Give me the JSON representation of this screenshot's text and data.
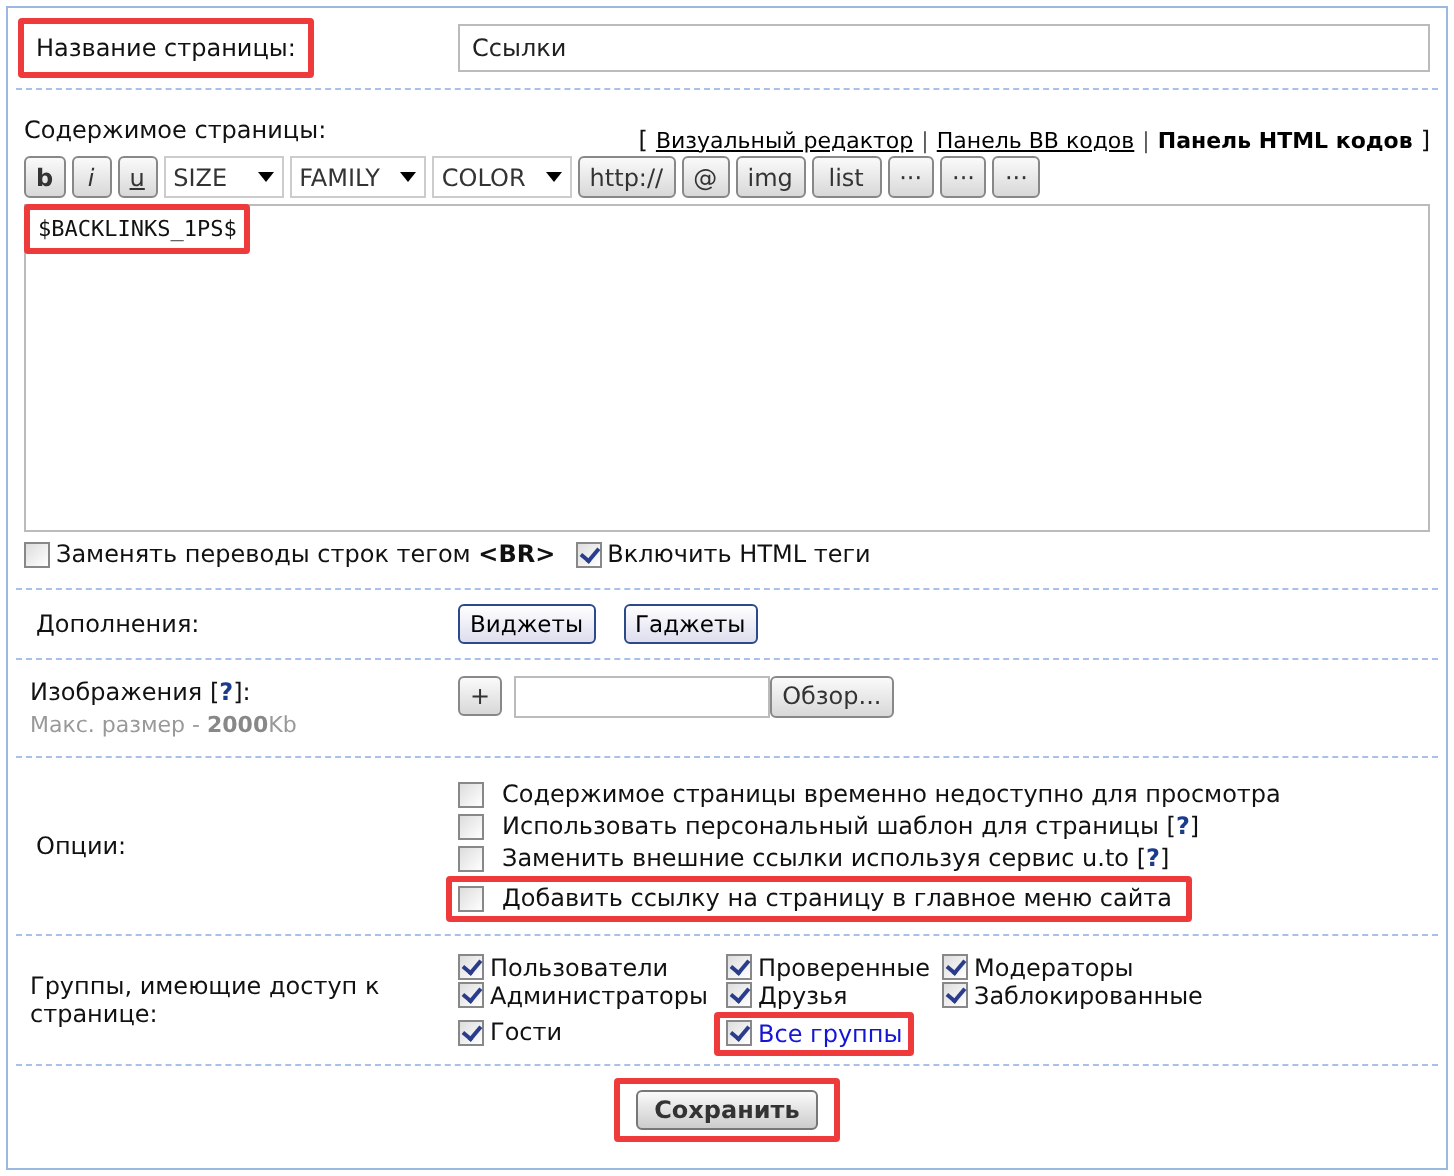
{
  "title_row": {
    "label": "Название страницы:",
    "label_highlighted": true,
    "value": "Ссылки"
  },
  "content": {
    "label": "Содержимое страницы:",
    "modes_open": "[",
    "modes_close": "]",
    "mode_separators": [
      "|",
      "|"
    ],
    "editor_modes": [
      {
        "label": "Визуальный редактор",
        "selected": false
      },
      {
        "label": "Панель BB кодов",
        "selected": false
      },
      {
        "label": "Панель HTML кодов",
        "selected": true
      }
    ],
    "toolbar": [
      {
        "kind": "button",
        "label": "b"
      },
      {
        "kind": "button",
        "label": "i"
      },
      {
        "kind": "button",
        "label": "u"
      },
      {
        "kind": "select",
        "label": "SIZE"
      },
      {
        "kind": "select",
        "label": "FAMILY"
      },
      {
        "kind": "select",
        "label": "COLOR"
      },
      {
        "kind": "button",
        "label": "http://"
      },
      {
        "kind": "button",
        "label": "@"
      },
      {
        "kind": "button",
        "label": "img"
      },
      {
        "kind": "button",
        "label": "list"
      },
      {
        "kind": "button",
        "label": "···"
      },
      {
        "kind": "button",
        "label": "···"
      },
      {
        "kind": "button",
        "label": "···"
      }
    ],
    "text": "$BACKLINKS_1PS$",
    "text_highlighted": true,
    "checkboxes": [
      {
        "label": "Заменять переводы строк тегом **<BR>**",
        "checked": false
      },
      {
        "label": "Включить HTML теги",
        "checked": true
      }
    ]
  },
  "addons": {
    "label": "Дополнения:",
    "buttons": [
      "Виджеты",
      "Гаджеты"
    ]
  },
  "images": {
    "label": "Изображения [**?**]:",
    "hint": "Макс. размер - **2000**Kb",
    "add": "+",
    "browse": "Обзор..."
  },
  "options": {
    "label": "Опции:",
    "items": [
      {
        "label": "Содержимое страницы временно недоступно для просмотра",
        "checked": false,
        "highlighted": false
      },
      {
        "label": "Использовать персональный шаблон для страницы [**?**]",
        "checked": false,
        "highlighted": false
      },
      {
        "label": "Заменить внешние ссылки используя сервис u.to [**?**]",
        "checked": false,
        "highlighted": false
      },
      {
        "label": "Добавить ссылку на страницу в главное меню сайта",
        "checked": false,
        "highlighted": true
      }
    ]
  },
  "groups": {
    "label": "Группы, имеющие доступ к странице:",
    "items": [
      {
        "label": "Пользователи",
        "checked": true,
        "kind": "group",
        "highlighted": false
      },
      {
        "label": "Проверенные",
        "checked": true,
        "kind": "group",
        "highlighted": false
      },
      {
        "label": "Модераторы",
        "checked": true,
        "kind": "group",
        "highlighted": false
      },
      {
        "label": "Администраторы",
        "checked": true,
        "kind": "group",
        "highlighted": false
      },
      {
        "label": "Друзья",
        "checked": true,
        "kind": "group",
        "highlighted": false
      },
      {
        "label": "Заблокированные",
        "checked": true,
        "kind": "group",
        "highlighted": false
      },
      {
        "label": "Гости",
        "checked": true,
        "kind": "group",
        "highlighted": false
      },
      {
        "label": "Все группы",
        "checked": true,
        "kind": "all",
        "highlighted": true
      }
    ]
  },
  "save": {
    "label": "Сохранить",
    "highlighted": true
  }
}
